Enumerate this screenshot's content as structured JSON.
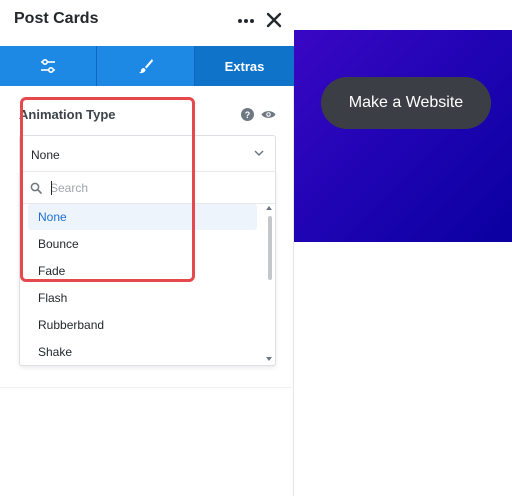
{
  "panel": {
    "title": "Post Cards",
    "more_icon": "ellipsis-icon",
    "close_icon": "close-icon"
  },
  "tabs": [
    {
      "icon": "sliders-icon",
      "label": ""
    },
    {
      "icon": "brush-icon",
      "label": ""
    },
    {
      "icon": "",
      "label": "Extras",
      "active": true
    }
  ],
  "animation": {
    "label": "Animation Type",
    "help_icon": "question-circle-icon",
    "visibility_icon": "eye-icon",
    "selected_value": "None",
    "search_placeholder": "Search",
    "options": [
      "None",
      "Bounce",
      "Fade",
      "Flash",
      "Rubberband",
      "Shake"
    ],
    "selected_index": 0
  },
  "preview": {
    "button_label": "Make a Website"
  },
  "colors": {
    "tab_bg": "#1e88e5",
    "tab_active_bg": "#0f73c9",
    "highlight": "#e5484d",
    "selected_text": "#1e6fd0",
    "preview_gradient_start": "#3a07c4",
    "preview_gradient_end": "#0a00a0"
  }
}
